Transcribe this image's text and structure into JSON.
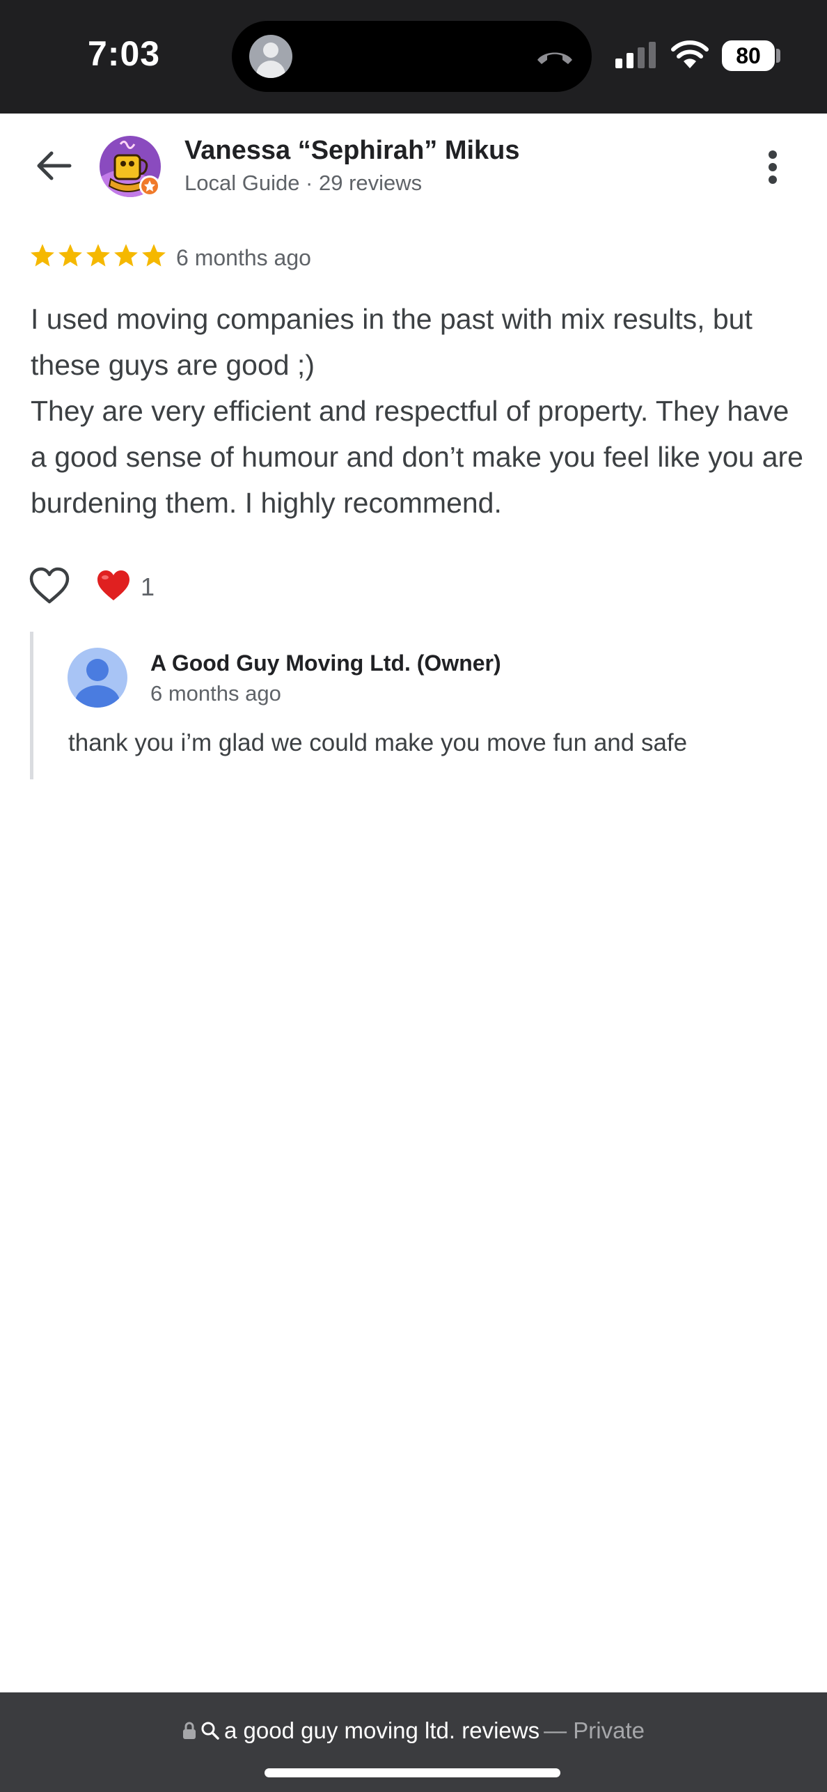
{
  "status_bar": {
    "time": "7:03",
    "battery": "80",
    "icons": [
      "caller-avatar-icon",
      "hang-up-icon",
      "cellular-signal-icon",
      "wifi-icon",
      "battery-icon"
    ]
  },
  "header": {
    "reviewer_name": "Vanessa “Sephirah” Mikus",
    "reviewer_meta": "Local Guide · 29 reviews",
    "icons": [
      "back-arrow-icon",
      "more-vert-icon"
    ]
  },
  "review": {
    "rating": 5,
    "date": "6 months ago",
    "paragraphs": [
      "I used moving companies in the past with mix results, but these guys are good ;)",
      "They are very efficient and respectful of property. They have a good sense of humour and don’t make you feel like you are burdening them. I highly recommend."
    ],
    "reaction_count": "1"
  },
  "owner_reply": {
    "name": "A Good Guy Moving Ltd. (Owner)",
    "date": "6 months ago",
    "text": "thank you i’m glad we could make you move fun and safe"
  },
  "browser": {
    "url_text": "a good guy moving ltd. reviews",
    "mode": "— Private"
  },
  "colors": {
    "star": "#f5b800",
    "heart": "#e02020",
    "status_bar_bg": "#1f1f21",
    "browser_bar_bg": "#3b3c3f",
    "owner_avatar": "#4a7ce0",
    "badge": "#f07a2a"
  }
}
